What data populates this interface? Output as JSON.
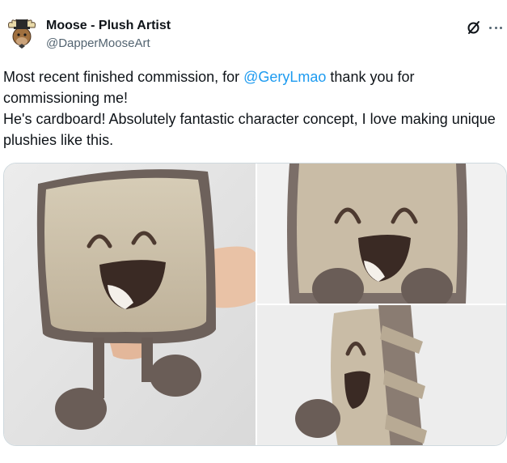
{
  "author": {
    "name": "Moose - Plush Artist",
    "handle": "@DapperMooseArt"
  },
  "icons": {
    "avatar": "moose-avatar",
    "grok": "grok-icon",
    "more": "more-icon"
  },
  "tweet": {
    "line1_before": "Most recent finished commission, for ",
    "mention": "@GeryLmao",
    "line1_after": " thank you for commissioning me!",
    "line2": "He's cardboard! Absolutely fantastic character concept, I love making unique plushies like this."
  },
  "colors": {
    "mention": "#1d9bf0",
    "handle": "#536471",
    "plush_body": "#c9bca6",
    "plush_dark": "#6a5d57"
  }
}
